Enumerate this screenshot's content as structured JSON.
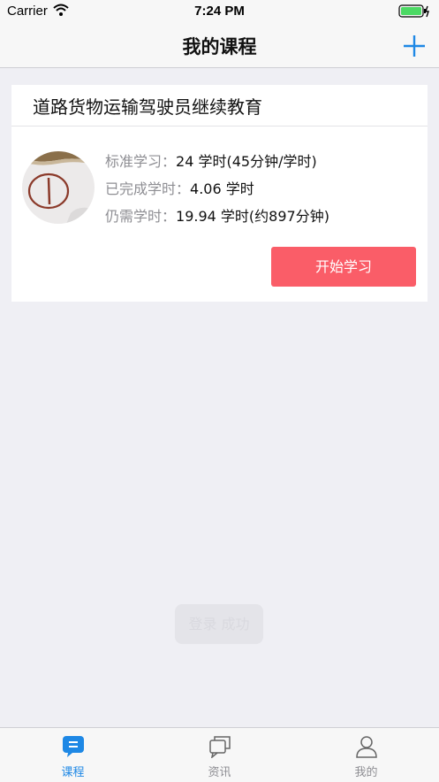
{
  "status_bar": {
    "carrier": "Carrier",
    "time": "7:24 PM"
  },
  "nav": {
    "title": "我的课程"
  },
  "course": {
    "title": "道路货物运输驾驶员继续教育",
    "rows": [
      {
        "label": "标准学习：",
        "value": "24 学时(45分钟/学时)"
      },
      {
        "label": "已完成学时：",
        "value": "4.06 学时"
      },
      {
        "label": "仍需学时：",
        "value": "19.94 学时(约897分钟)"
      }
    ],
    "start_label": "开始学习"
  },
  "toast": {
    "text": "登录 成功"
  },
  "tabs": [
    {
      "label": "课程",
      "icon": "course-icon",
      "active": true
    },
    {
      "label": "资讯",
      "icon": "news-icon",
      "active": false
    },
    {
      "label": "我的",
      "icon": "profile-icon",
      "active": false
    }
  ],
  "colors": {
    "accent": "#1e88e5",
    "start_button": "#fa5d68",
    "inactive": "#8e8e93"
  }
}
